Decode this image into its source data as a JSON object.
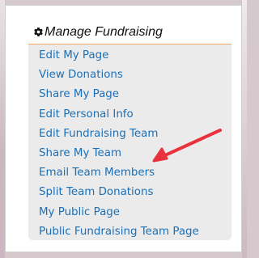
{
  "panel": {
    "title": "Manage Fundraising",
    "icon": "gear-icon",
    "header_border_color": "#f0a35a"
  },
  "menu": {
    "items": [
      {
        "label": "Edit My Page"
      },
      {
        "label": "View Donations"
      },
      {
        "label": "Share My Page"
      },
      {
        "label": "Edit Personal Info"
      },
      {
        "label": "Edit Fundraising Team"
      },
      {
        "label": "Share My Team"
      },
      {
        "label": "Email Team Members"
      },
      {
        "label": "Split Team Donations"
      },
      {
        "label": "My Public Page"
      },
      {
        "label": "Public Fundraising Team Page"
      }
    ],
    "link_color": "#1b6fb6"
  },
  "annotation": {
    "arrow_color": "#e8333f",
    "points_to": "Email Team Members"
  }
}
